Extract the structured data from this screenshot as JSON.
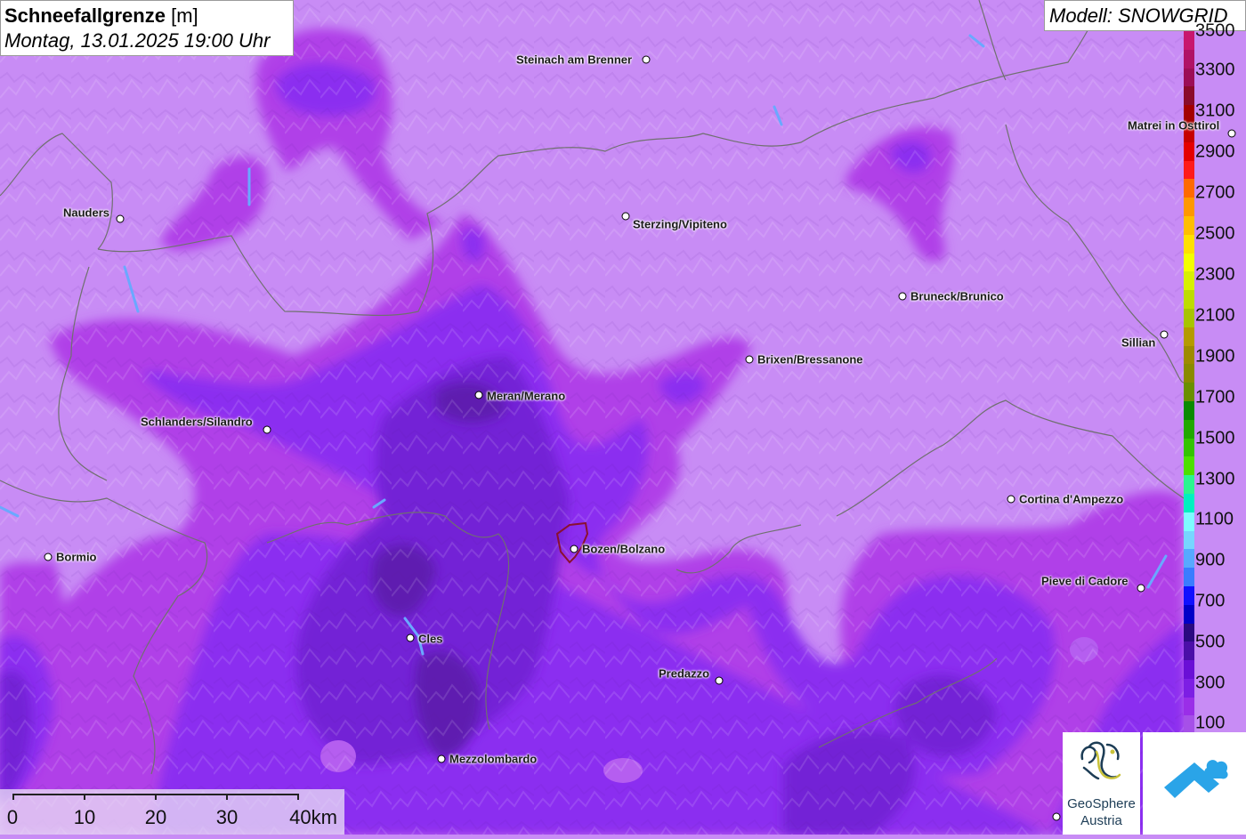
{
  "header": {
    "title_bold": "Schneefallgrenze",
    "title_unit": "[m]",
    "datetime": "Montag, 13.01.2025 19:00 Uhr"
  },
  "model": {
    "label": "Modell: SNOWGRID"
  },
  "legend": {
    "labels": [
      "3500",
      "3300",
      "3100",
      "2900",
      "2700",
      "2500",
      "2300",
      "2100",
      "1900",
      "1700",
      "1500",
      "1300",
      "1100",
      "900",
      "700",
      "500",
      "300",
      "100"
    ],
    "colors": [
      "#c8176e",
      "#b01266",
      "#9c0e56",
      "#8a0b2a",
      "#a30000",
      "#c60000",
      "#e40000",
      "#ff1a1a",
      "#ff6a00",
      "#ff9800",
      "#ffbe00",
      "#ffe000",
      "#f4ff00",
      "#d8f000",
      "#bedc00",
      "#a8c400",
      "#b59a00",
      "#9e8a00",
      "#8a8a00",
      "#6a8f00",
      "#0a8a00",
      "#21a800",
      "#33c400",
      "#4ce000",
      "#2bf58f",
      "#00f0c0",
      "#7efcff",
      "#77d5ff",
      "#57a9ff",
      "#3a7cff",
      "#1010ff",
      "#0000c8",
      "#2a0a80",
      "#4b0fa8",
      "#6a0fd6",
      "#7d1ee4",
      "#9a2ee8",
      "#a650e8"
    ]
  },
  "cities": [
    {
      "name": "Steinach am Brenner"
    },
    {
      "name": "Matrei in Osttirol"
    },
    {
      "name": "Nauders"
    },
    {
      "name": "Sterzing/Vipiteno"
    },
    {
      "name": "Bruneck/Brunico"
    },
    {
      "name": "Sillian"
    },
    {
      "name": "Brixen/Bressanone"
    },
    {
      "name": "Meran/Merano"
    },
    {
      "name": "Schlanders/Silandro"
    },
    {
      "name": "Cortina d'Ampezzo"
    },
    {
      "name": "Bormio"
    },
    {
      "name": "Bozen/Bolzano"
    },
    {
      "name": "Pieve di Cadore"
    },
    {
      "name": "Cles"
    },
    {
      "name": "Predazzo"
    },
    {
      "name": "Mezzolombardo"
    }
  ],
  "scale": {
    "labels": [
      "0",
      "10",
      "20",
      "30",
      "40km"
    ]
  },
  "logos": {
    "geosphere_line1": "GeoSphere",
    "geosphere_line2": "Austria"
  },
  "colors": {
    "light_lilac": "#c88cf5",
    "magenta_band": "#b040e8",
    "violet": "#8b2ff0",
    "deep_violet": "#7322d6",
    "dark_violet": "#5e1db0",
    "border_gray": "#707070",
    "bolzano_outline": "#8a1030"
  }
}
